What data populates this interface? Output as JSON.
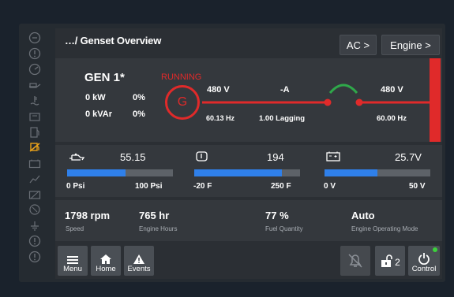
{
  "header": {
    "breadcrumb": "…/ Genset Overview",
    "ac_button": "AC >",
    "engine_button": "Engine >"
  },
  "generator": {
    "name": "GEN 1*",
    "status": "RUNNING",
    "symbol": "G",
    "kw": "0  kW",
    "kw_pct": "0%",
    "kvar": "0  kVAr",
    "kvar_pct": "0%",
    "gen_voltage": "480 V",
    "current": "-A",
    "gen_freq": "60.13 Hz",
    "power_factor": "1.00 Lagging",
    "bus_voltage": "480 V",
    "bus_freq": "60.00 Hz"
  },
  "gauges": [
    {
      "icon": "oil-pressure-icon",
      "value": "55.15",
      "min": "0 Psi",
      "max": "100 Psi",
      "level": 0.55
    },
    {
      "icon": "coolant-temp-icon",
      "value": "194",
      "min": "-20 F",
      "max": "250 F",
      "level": 0.83
    },
    {
      "icon": "battery-icon",
      "value": "25.7V",
      "min": "0 V",
      "max": "50 V",
      "level": 0.5
    }
  ],
  "stats": [
    {
      "value": "1798 rpm",
      "label": "Speed"
    },
    {
      "value": "765 hr",
      "label": "Engine Hours"
    },
    {
      "value": "77 %",
      "label": "Fuel Quantity"
    },
    {
      "value": "Auto",
      "label": "Engine Operating Mode"
    }
  ],
  "bottom": {
    "menu": "Menu",
    "home": "Home",
    "events": "Events",
    "lock_count": "2",
    "control": "Control"
  },
  "colors": {
    "running_red": "#e02a2a",
    "breaker_green": "#2fa84a",
    "bar_blue": "#2f80ea",
    "status_dot": "#3cd13c"
  }
}
